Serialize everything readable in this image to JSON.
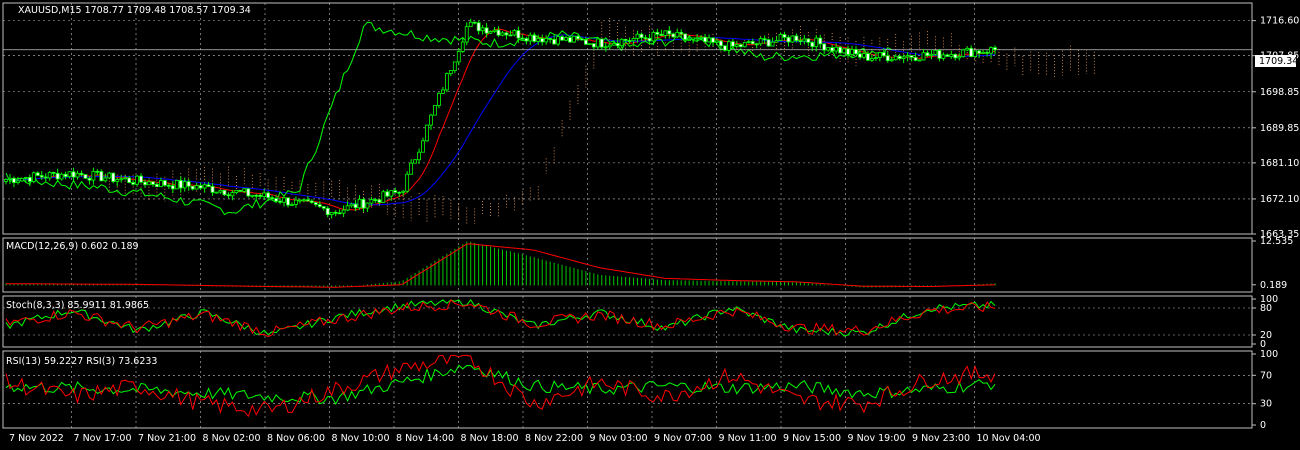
{
  "colors": {
    "background": "#000000",
    "grid": "#c0c0c0",
    "frame": "#c0c0c0",
    "text": "#ffffff",
    "candle_up": "#00ff00",
    "price_line": "#c0c0c0",
    "macd_signal": "#ff0000",
    "macd_hist": "#00c800",
    "stoch_main": "#00ff00",
    "stoch_signal": "#ff0000",
    "rsi13": "#00ff00",
    "rsi3": "#ff0000",
    "tenkan": "#ff0000",
    "kijun": "#0000ff",
    "chikou": "#00ff00",
    "cloud": "#f4a460"
  },
  "main_window": {
    "header": "XAUUSD,M15  1708.77 1709.48 1708.57 1709.34",
    "bid_label": "1709.34",
    "y_axis_labels": [
      "1716.60",
      "1707.85",
      "1698.85",
      "1689.85",
      "1681.10",
      "1672.10",
      "1663.35"
    ]
  },
  "macd_window": {
    "header": "MACD(12,26,9) 0.602 0.189",
    "y_axis_labels": [
      "12.535",
      "0.189"
    ]
  },
  "stoch_window": {
    "header": "Stoch(8,3,3) 85.9911 81.9865",
    "y_axis_labels": [
      "100",
      "80",
      "20",
      "0"
    ]
  },
  "rsi_window": {
    "header": "RSI(13) 59.2227  RSI(3) 73.6233",
    "y_axis_labels": [
      "100",
      "70",
      "30",
      "0"
    ]
  },
  "x_axis_labels": [
    "7 Nov 2022",
    "7 Nov 17:00",
    "7 Nov 21:00",
    "8 Nov 02:00",
    "8 Nov 06:00",
    "8 Nov 10:00",
    "8 Nov 14:00",
    "8 Nov 18:00",
    "8 Nov 22:00",
    "9 Nov 03:00",
    "9 Nov 07:00",
    "9 Nov 11:00",
    "9 Nov 15:00",
    "9 Nov 19:00",
    "9 Nov 23:00",
    "10 Nov 04:00"
  ],
  "chart_data": [
    {
      "type": "candlestick",
      "ylim": [
        1663.35,
        1721.0
      ],
      "x": [
        "7 Nov 2022",
        "7 Nov 17:00",
        "7 Nov 21:00",
        "8 Nov 02:00",
        "8 Nov 06:00",
        "8 Nov 10:00",
        "8 Nov 14:00",
        "8 Nov 18:00",
        "8 Nov 22:00",
        "9 Nov 03:00",
        "9 Nov 07:00",
        "9 Nov 11:00",
        "9 Nov 15:00",
        "9 Nov 19:00",
        "9 Nov 23:00",
        "10 Nov 04:00"
      ],
      "close": [
        1677.0,
        1678.5,
        1676.5,
        1675.0,
        1672.5,
        1669.0,
        1674.0,
        1715.5,
        1712.5,
        1711.0,
        1713.0,
        1710.0,
        1712.5,
        1707.5,
        1708.0,
        1709.34
      ],
      "last_price": 1709.34,
      "grid": true
    },
    {
      "type": "bar",
      "series": [
        {
          "name": "MACD",
          "values": [
            0.6,
            0.4,
            0.2,
            -0.2,
            -0.5,
            -0.6,
            1.2,
            12.5,
            8.0,
            3.0,
            1.5,
            1.2,
            0.9,
            -0.6,
            -0.4,
            0.602
          ]
        },
        {
          "name": "Signal",
          "values": [
            0.5,
            0.4,
            0.3,
            0.0,
            -0.3,
            -0.5,
            0.2,
            11.8,
            10.0,
            5.0,
            2.0,
            1.4,
            1.0,
            -0.2,
            -0.3,
            0.189
          ]
        }
      ],
      "ylim": [
        -1.0,
        12.535
      ]
    },
    {
      "type": "line",
      "series": [
        {
          "name": "Stoch main",
          "values": [
            40,
            75,
            30,
            70,
            20,
            60,
            85,
            95,
            40,
            70,
            35,
            80,
            30,
            25,
            80,
            85.9911
          ]
        },
        {
          "name": "Stoch signal",
          "values": [
            45,
            70,
            35,
            65,
            25,
            55,
            80,
            92,
            45,
            65,
            40,
            75,
            35,
            30,
            75,
            81.9865
          ]
        }
      ],
      "ylim": [
        0,
        100
      ]
    },
    {
      "type": "line",
      "series": [
        {
          "name": "RSI(13)",
          "values": [
            55,
            52,
            50,
            45,
            40,
            38,
            60,
            85,
            55,
            50,
            55,
            52,
            55,
            45,
            50,
            59.2227
          ]
        },
        {
          "name": "RSI(3)",
          "values": [
            60,
            40,
            55,
            30,
            20,
            50,
            80,
            95,
            30,
            60,
            40,
            70,
            35,
            30,
            65,
            73.6233
          ]
        }
      ],
      "ylim": [
        0,
        100
      ]
    }
  ]
}
